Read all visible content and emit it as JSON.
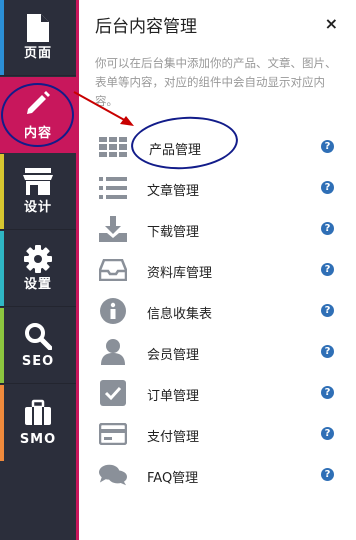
{
  "nav": {
    "items": [
      {
        "label": "页面",
        "icon": "page-icon",
        "color": "#2b8fd6"
      },
      {
        "label": "内容",
        "icon": "pencil-icon",
        "color": "#c8175c",
        "active": true
      },
      {
        "label": "设计",
        "icon": "store-icon",
        "color": "#d6c630"
      },
      {
        "label": "设置",
        "icon": "gear-icon",
        "color": "#2fb6c4"
      },
      {
        "label": "SEO",
        "icon": "search-icon",
        "color": "#8cc63f"
      },
      {
        "label": "SMO",
        "icon": "briefcase-icon",
        "color": "#f08a3c"
      }
    ]
  },
  "panel": {
    "title": "后台内容管理",
    "close": "×",
    "description": "你可以在后台集中添加你的产品、文章、图片、表单等内容，对应的组件中会自动显示对应内容。",
    "help": "?",
    "items": [
      {
        "label": "产品管理",
        "icon": "grid-icon"
      },
      {
        "label": "文章管理",
        "icon": "list-icon"
      },
      {
        "label": "下载管理",
        "icon": "download-icon"
      },
      {
        "label": "资料库管理",
        "icon": "inbox-icon"
      },
      {
        "label": "信息收集表",
        "icon": "info-icon"
      },
      {
        "label": "会员管理",
        "icon": "user-icon"
      },
      {
        "label": "订单管理",
        "icon": "checkbox-icon"
      },
      {
        "label": "支付管理",
        "icon": "card-icon"
      },
      {
        "label": "FAQ管理",
        "icon": "chat-icon"
      }
    ]
  },
  "colors": {
    "accent": "#c8175c",
    "rail": "#2b2e3b",
    "icon": "#8a9099",
    "help": "#2f6fb6",
    "annotation": "#121c8a",
    "arrow": "#c80000"
  }
}
